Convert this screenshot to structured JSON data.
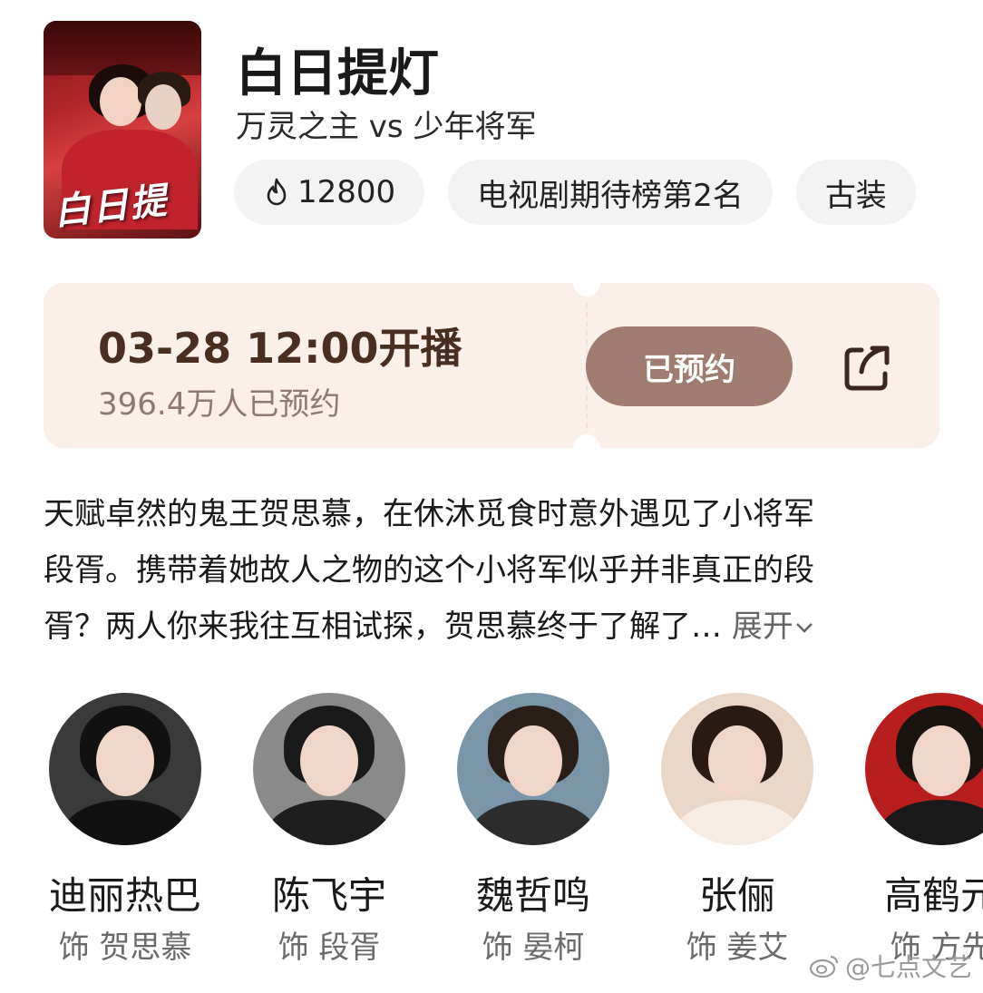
{
  "show": {
    "title": "白日提灯",
    "subtitle": "万灵之主 vs 少年将军",
    "poster_logo": "白日提灯"
  },
  "tags": [
    {
      "label": "12800",
      "icon": "flame-icon"
    },
    {
      "label": "电视剧期待榜第2名"
    },
    {
      "label": "古装"
    }
  ],
  "premiere": {
    "datetime": "03-28 12:00开播",
    "reserved_count": "396.4万人已预约",
    "booked_button": "已预约",
    "share_icon": "share-icon",
    "accent_color": "#a07b70"
  },
  "description": {
    "lines": [
      "天赋卓然的鬼王贺思慕，在休沐觅食时意外遇见了小将军",
      "段胥。携带着她故人之物的这个小将军似乎并非真正的段",
      "胥？两人你来我往互相试探，贺思慕终于了解了…"
    ],
    "expand_label": "展开"
  },
  "cast": [
    {
      "name": "迪丽热巴",
      "role": "饰 贺思慕"
    },
    {
      "name": "陈飞宇",
      "role": "饰 段胥"
    },
    {
      "name": "魏哲鸣",
      "role": "饰 晏柯"
    },
    {
      "name": "张俪",
      "role": "饰 姜艾"
    },
    {
      "name": "高鹤元",
      "role": "饰 方先"
    }
  ],
  "watermark": "@七点文艺"
}
